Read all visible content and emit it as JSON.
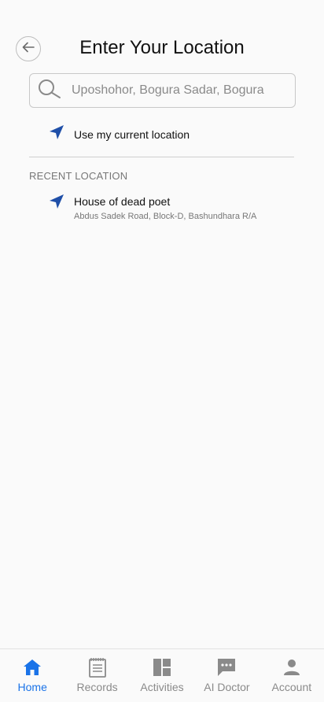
{
  "header": {
    "title": "Enter Your Location",
    "back_icon": "arrow-left-icon"
  },
  "search": {
    "placeholder": "Uposhohor, Bogura Sadar, Bogura",
    "value": "",
    "icon": "search-icon"
  },
  "current_location": {
    "label": "Use my current location",
    "icon": "navigation-arrow-icon"
  },
  "recent": {
    "header": "RECENT LOCATION",
    "items": [
      {
        "name": "House of dead poet",
        "address": "Abdus Sadek Road, Block-D, Bashundhara R/A",
        "icon": "navigation-arrow-icon"
      }
    ]
  },
  "bottom_nav": {
    "items": [
      {
        "label": "Home",
        "icon": "home-icon",
        "active": true
      },
      {
        "label": "Records",
        "icon": "records-icon",
        "active": false
      },
      {
        "label": "Activities",
        "icon": "activities-icon",
        "active": false
      },
      {
        "label": "AI Doctor",
        "icon": "chat-icon",
        "active": false
      },
      {
        "label": "Account",
        "icon": "person-icon",
        "active": false
      }
    ]
  },
  "colors": {
    "accent": "#1a73e8",
    "nav_arrow": "#1f4fa8",
    "inactive": "#8a8a8a",
    "background": "#fafafa"
  }
}
